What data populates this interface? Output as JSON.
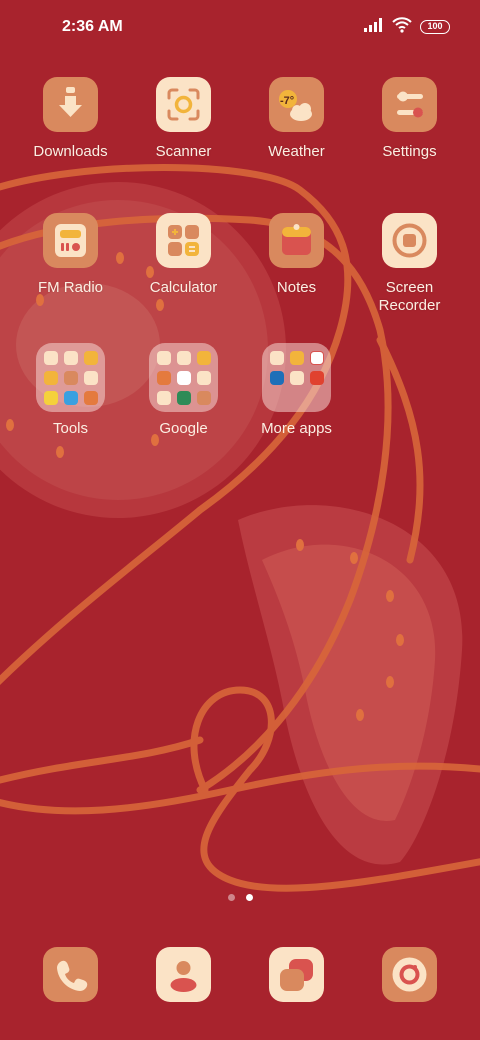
{
  "status_bar": {
    "time": "2:36 AM",
    "battery": "100",
    "icons": [
      "signal-icon",
      "wifi-icon",
      "battery-icon"
    ]
  },
  "apps": {
    "downloads": {
      "label": "Downloads",
      "icon": "download-icon"
    },
    "scanner": {
      "label": "Scanner",
      "icon": "scanner-icon"
    },
    "weather": {
      "label": "Weather",
      "icon": "weather-icon",
      "temp": "-7°"
    },
    "settings": {
      "label": "Settings",
      "icon": "settings-icon"
    },
    "fm_radio": {
      "label": "FM Radio",
      "icon": "radio-icon"
    },
    "calculator": {
      "label": "Calculator",
      "icon": "calculator-icon"
    },
    "notes": {
      "label": "Notes",
      "icon": "notes-icon"
    },
    "screen_recorder": {
      "label": "Screen\nRecorder",
      "icon": "screen-recorder-icon"
    }
  },
  "folders": {
    "tools": {
      "label": "Tools"
    },
    "google": {
      "label": "Google"
    },
    "more_apps": {
      "label": "More apps"
    }
  },
  "dock": {
    "items": [
      "phone-icon",
      "contacts-icon",
      "messages-icon",
      "camera-icon"
    ]
  },
  "pages": {
    "count": 2,
    "current": 2
  },
  "colors": {
    "wallpaper": "#A8232D",
    "tile_tan": "#D9895E",
    "tile_cream": "#FBE3C6",
    "accent_yellow": "#F2B43B",
    "accent_red": "#D9534F"
  }
}
